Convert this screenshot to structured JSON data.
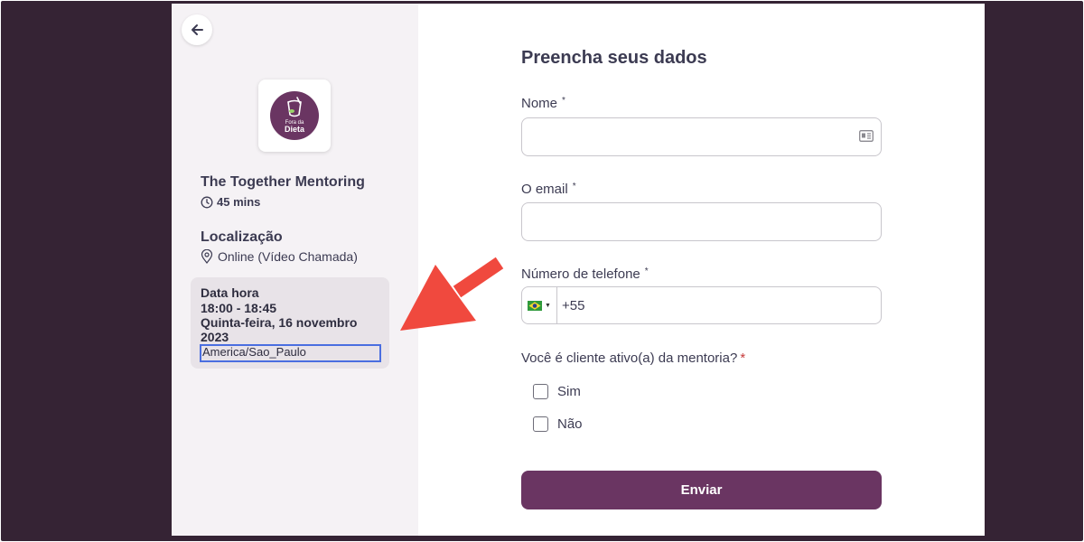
{
  "event": {
    "logo_text_line1": "Fora da",
    "logo_text_line2": "Dieta",
    "title": "The Together Mentoring",
    "duration": "45 mins",
    "location_heading": "Localização",
    "location_value": "Online (Vídeo Chamada)",
    "datetime_heading": "Data hora",
    "time_range": "18:00 - 18:45",
    "date_line1": "Quinta-feira, 16 novembro",
    "date_line2": "2023",
    "timezone": "America/Sao_Paulo"
  },
  "form": {
    "title": "Preencha seus dados",
    "name_label": "Nome",
    "email_label": "O email",
    "phone_label": "Número de telefone",
    "required_mark": "*",
    "phone_value": "+55",
    "question": "Você é cliente ativo(a) da mentoria?",
    "options": [
      "Sim",
      "Não"
    ],
    "submit_label": "Enviar"
  },
  "colors": {
    "backdrop": "#352334",
    "left_panel": "#f5f2f5",
    "brand": "#6a3562",
    "highlight_border": "#4a6ee0",
    "annotation_arrow": "#f0493e"
  },
  "icons": {
    "back": "arrow-left-icon",
    "clock": "clock-icon",
    "location": "map-pin-icon",
    "contact_card": "contact-card-icon",
    "flag": "brazil-flag-icon"
  }
}
